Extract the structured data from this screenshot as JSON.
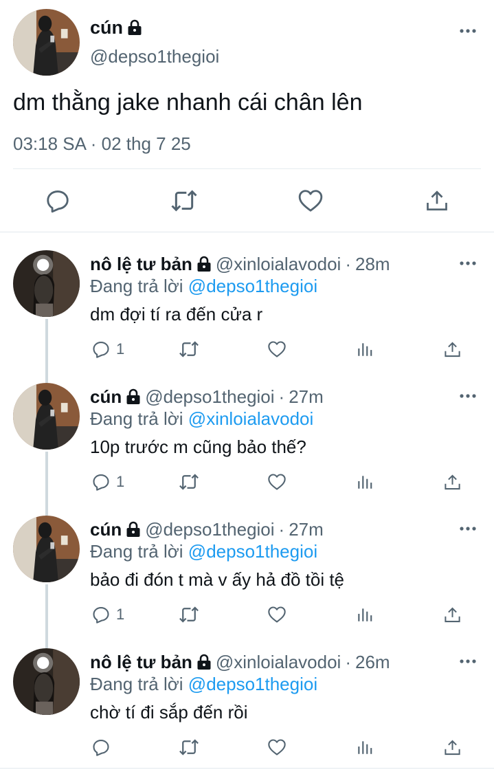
{
  "main_tweet": {
    "display_name": "cún",
    "handle": "@depso1thegioi",
    "text": "dm thằng jake nhanh cái chân lên",
    "timestamp": "03:18 SA · 02 thg 7 25"
  },
  "icons": {
    "lock": "lock-icon",
    "more": "more-icon",
    "reply": "reply-icon",
    "retweet": "retweet-icon",
    "like": "heart-icon",
    "analytics": "analytics-icon",
    "share": "share-icon"
  },
  "colors": {
    "text": "#0f1419",
    "secondary": "#536471",
    "mention": "#1d9bf0",
    "thread_line": "#cfd9de"
  },
  "replying_label": "Đang trả lời",
  "replies": [
    {
      "display_name": "nô lệ tư bản",
      "handle": "@xinloialavodoi",
      "separator": "·",
      "time": "28m",
      "replying_to": "@depso1thegioi",
      "text": "dm đợi tí ra đến cửa r",
      "reply_count": "1"
    },
    {
      "display_name": "cún",
      "handle": "@depso1thegioi",
      "separator": "·",
      "time": "27m",
      "replying_to": "@xinloialavodoi",
      "text": "10p trước m cũng bảo thế?",
      "reply_count": "1"
    },
    {
      "display_name": "cún",
      "handle": "@depso1thegioi",
      "separator": "·",
      "time": "27m",
      "replying_to": "@depso1thegioi",
      "text": "bảo đi đón t mà v ấy hả đồ tồi tệ",
      "reply_count": "1"
    },
    {
      "display_name": "nô lệ tư bản",
      "handle": "@xinloialavodoi",
      "separator": "·",
      "time": "26m",
      "replying_to": "@depso1thegioi",
      "text": "chờ tí đi sắp đến rồi",
      "reply_count": ""
    }
  ]
}
